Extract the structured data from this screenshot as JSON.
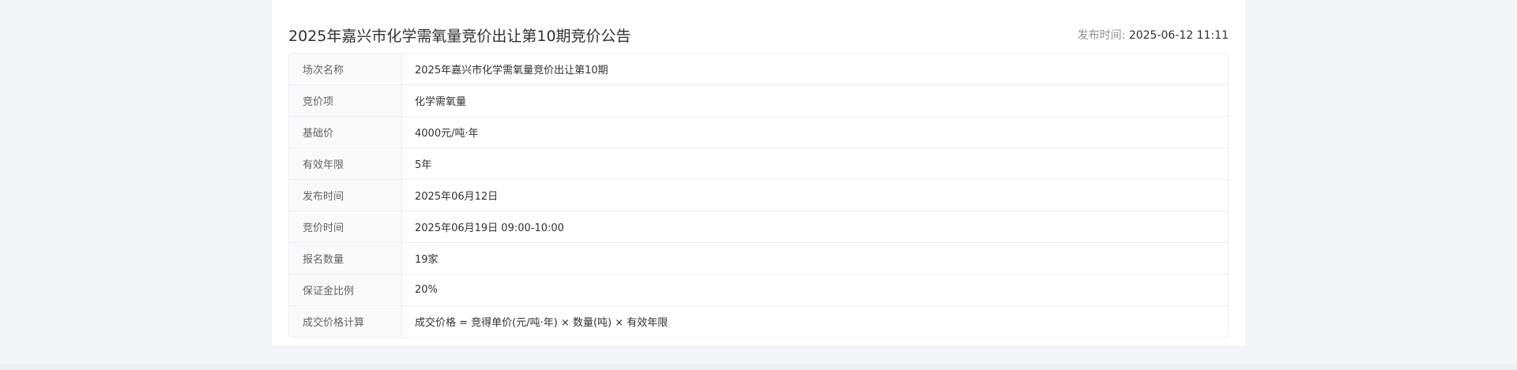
{
  "notice": {
    "title": "2025年嘉兴市化学需氧量竞价出让第10期竞价公告",
    "publish_label": "发布时间:",
    "publish_value": "2025-06-12 11:11"
  },
  "details": [
    {
      "label": "场次名称",
      "value": "2025年嘉兴市化学需氧量竞价出让第10期"
    },
    {
      "label": "竞价项",
      "value": "化学需氧量"
    },
    {
      "label": "基础价",
      "value": "4000元/吨·年"
    },
    {
      "label": "有效年限",
      "value": "5年"
    },
    {
      "label": "发布时间",
      "value": "2025年06月12日"
    },
    {
      "label": "竞价时间",
      "value": "2025年06月19日 09:00-10:00"
    },
    {
      "label": "报名数量",
      "value": "19家"
    },
    {
      "label": "保证金比例",
      "value": "20%"
    },
    {
      "label": "成交价格计算",
      "value": "成交价格 = 竞得单价(元/吨·年) × 数量(吨) × 有效年限"
    }
  ]
}
